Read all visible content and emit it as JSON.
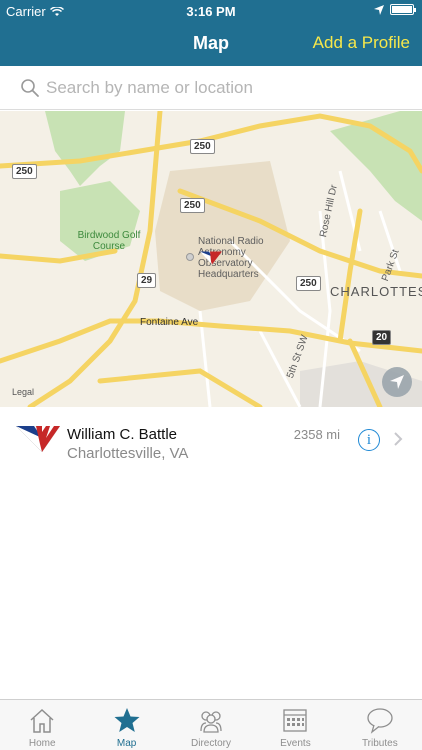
{
  "status": {
    "carrier": "Carrier",
    "time": "3:16 PM"
  },
  "nav": {
    "title": "Map",
    "add_profile": "Add a Profile"
  },
  "search": {
    "placeholder": "Search by name or location"
  },
  "map": {
    "labels": {
      "golf": "Birdwood Golf Course",
      "nrao": "National Radio Astronomy Observatory Headquarters",
      "fontaine": "Fontaine Ave",
      "rosehill": "Rose Hill Dr",
      "park": "Park St",
      "fifth": "5th St SW",
      "city": "CHARLOTTES"
    },
    "shields": [
      "250",
      "250",
      "250",
      "250",
      "29",
      "20"
    ],
    "legal": "Legal"
  },
  "results": [
    {
      "name": "William C. Battle",
      "location": "Charlottesville, VA",
      "distance": "2358 mi"
    }
  ],
  "tabs": [
    {
      "label": "Home",
      "icon": "home-icon",
      "active": false
    },
    {
      "label": "Map",
      "icon": "star-icon",
      "active": true
    },
    {
      "label": "Directory",
      "icon": "people-icon",
      "active": false
    },
    {
      "label": "Events",
      "icon": "calendar-icon",
      "active": false
    },
    {
      "label": "Tributes",
      "icon": "speech-bubble-icon",
      "active": false
    }
  ],
  "colors": {
    "header": "#206f91",
    "accent": "#f7e84a",
    "active_tab": "#206f91",
    "info": "#1e88d4"
  }
}
